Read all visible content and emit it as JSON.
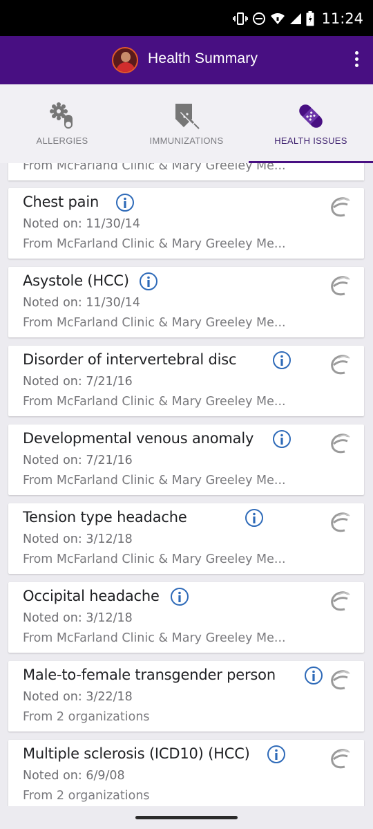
{
  "status_bar": {
    "time": "11:24"
  },
  "header": {
    "title": "Health Summary"
  },
  "tabs": [
    {
      "label": "ALLERGIES",
      "icon": "allergies-icon",
      "active": false
    },
    {
      "label": "IMMUNIZATIONS",
      "icon": "immunizations-icon",
      "active": false
    },
    {
      "label": "HEALTH ISSUES",
      "icon": "health-issues-icon",
      "active": true
    }
  ],
  "colors": {
    "brand": "#480f82",
    "info": "#2e6ab8"
  },
  "partial_item": {
    "source": "From McFarland Clinic & Mary Greeley Me..."
  },
  "health_issues": [
    {
      "title": "Chest pain",
      "noted": "Noted on: 11/30/14",
      "source": "From McFarland Clinic & Mary Greeley Me..."
    },
    {
      "title": "Asystole (HCC)",
      "noted": "Noted on: 11/30/14",
      "source": "From McFarland Clinic & Mary Greeley Me..."
    },
    {
      "title": "Disorder of intervertebral disc",
      "noted": "Noted on: 7/21/16",
      "source": "From McFarland Clinic & Mary Greeley Me..."
    },
    {
      "title": "Developmental venous anomaly",
      "noted": "Noted on: 7/21/16",
      "source": "From McFarland Clinic & Mary Greeley Me..."
    },
    {
      "title": "Tension type headache",
      "noted": "Noted on: 3/12/18",
      "source": "From McFarland Clinic & Mary Greeley Me..."
    },
    {
      "title": "Occipital headache",
      "noted": "Noted on: 3/12/18",
      "source": "From McFarland Clinic & Mary Greeley Me..."
    },
    {
      "title": "Male-to-female transgender person",
      "noted": "Noted on: 3/22/18",
      "source": "From 2 organizations"
    },
    {
      "title": "Multiple sclerosis (ICD10) (HCC)",
      "noted": "Noted on: 6/9/08",
      "source": "From 2 organizations"
    }
  ]
}
